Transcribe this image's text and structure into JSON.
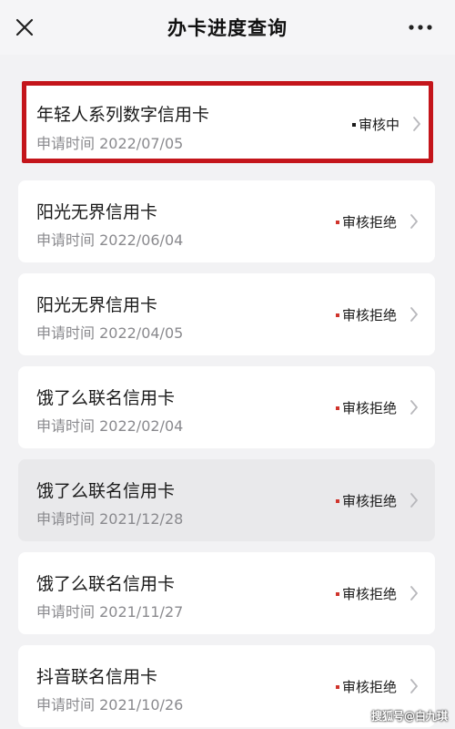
{
  "header": {
    "title": "办卡进度查询",
    "close_icon": "close-icon",
    "more_icon": "more-icon"
  },
  "colors": {
    "accent_red": "#c4151b",
    "status_pending_dot": "#1a1a1a",
    "status_rejected_dot": "#d0342c"
  },
  "applications": [
    {
      "name": "年轻人系列数字信用卡",
      "date": "申请时间 2022/07/05",
      "status": "审核中"
    },
    {
      "name": "阳光无界信用卡",
      "date": "申请时间 2022/06/04",
      "status": "审核拒绝"
    },
    {
      "name": "阳光无界信用卡",
      "date": "申请时间 2022/04/05",
      "status": "审核拒绝"
    },
    {
      "name": "饿了么联名信用卡",
      "date": "申请时间 2022/02/04",
      "status": "审核拒绝"
    },
    {
      "name": "饿了么联名信用卡",
      "date": "申请时间 2021/12/28",
      "status": "审核拒绝"
    },
    {
      "name": "饿了么联名信用卡",
      "date": "申请时间 2021/11/27",
      "status": "审核拒绝"
    },
    {
      "name": "抖音联名信用卡",
      "date": "申请时间 2021/10/26",
      "status": "审核拒绝"
    }
  ],
  "watermark": "搜狐号@白九琪"
}
